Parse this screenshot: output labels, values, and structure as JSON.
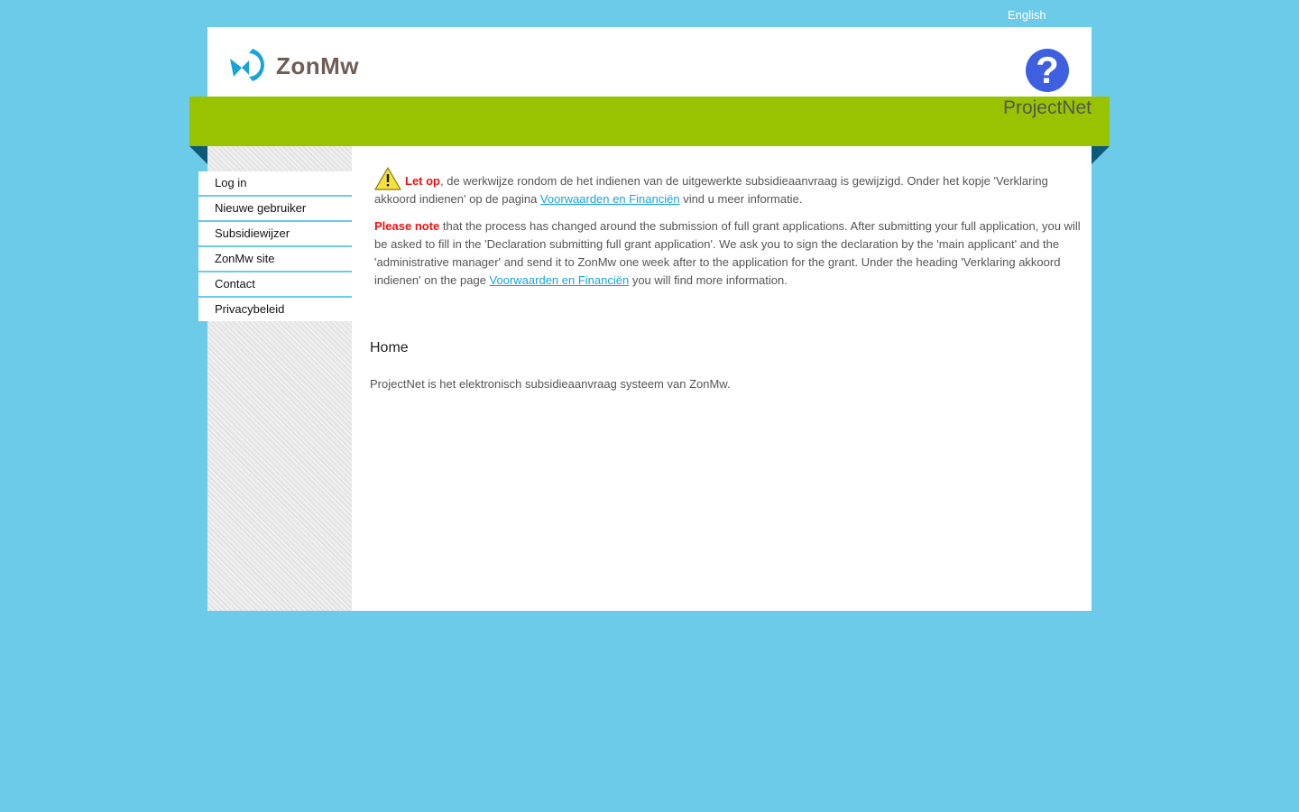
{
  "top": {
    "language_label": "English"
  },
  "header": {
    "logo_text": "ZonMw",
    "app_title": "ProjectNet",
    "help_symbol": "?"
  },
  "sidebar": {
    "items": [
      {
        "label": "Log in"
      },
      {
        "label": "Nieuwe gebruiker"
      },
      {
        "label": "Subsidiewijzer"
      },
      {
        "label": "ZonMw site"
      },
      {
        "label": "Contact"
      },
      {
        "label": "Privacybeleid"
      }
    ]
  },
  "notice": {
    "nl_prefix": "Let op",
    "nl_text_1": ", de werkwijze rondom de het indienen van de uitgewerkte subsidieaanvraag is gewijzigd. Onder het kopje 'Verklaring akkoord indienen' op de pagina ",
    "nl_link": "Voorwaarden en Financiën",
    "nl_text_2": " vind u meer informatie.",
    "en_prefix": "Please note",
    "en_text_1": " that the process has changed around the submission of full grant applications. After submitting your full application, you will be asked to fill in the 'Declaration submitting full grant application'. We ask you to sign the declaration by the 'main applicant' and the 'administrative manager' and send it to ZonMw one week after to the application for the grant. Under the heading 'Verklaring akkoord indienen' on the page ",
    "en_link": "Voorwaarden en Financiën",
    "en_text_2": " you will find more information."
  },
  "main": {
    "title": "Home",
    "intro": "ProjectNet is het elektronisch subsidieaanvraag systeem van ZonMw."
  },
  "colors": {
    "background": "#6ccbe8",
    "band": "#99c300",
    "fold": "#0d5a78",
    "link": "#1aa3d8",
    "warning_red": "#ee1111",
    "help_blue": "#3e5fe0",
    "logo_blue": "#1aa3d8",
    "logo_text": "#6e5e55"
  }
}
